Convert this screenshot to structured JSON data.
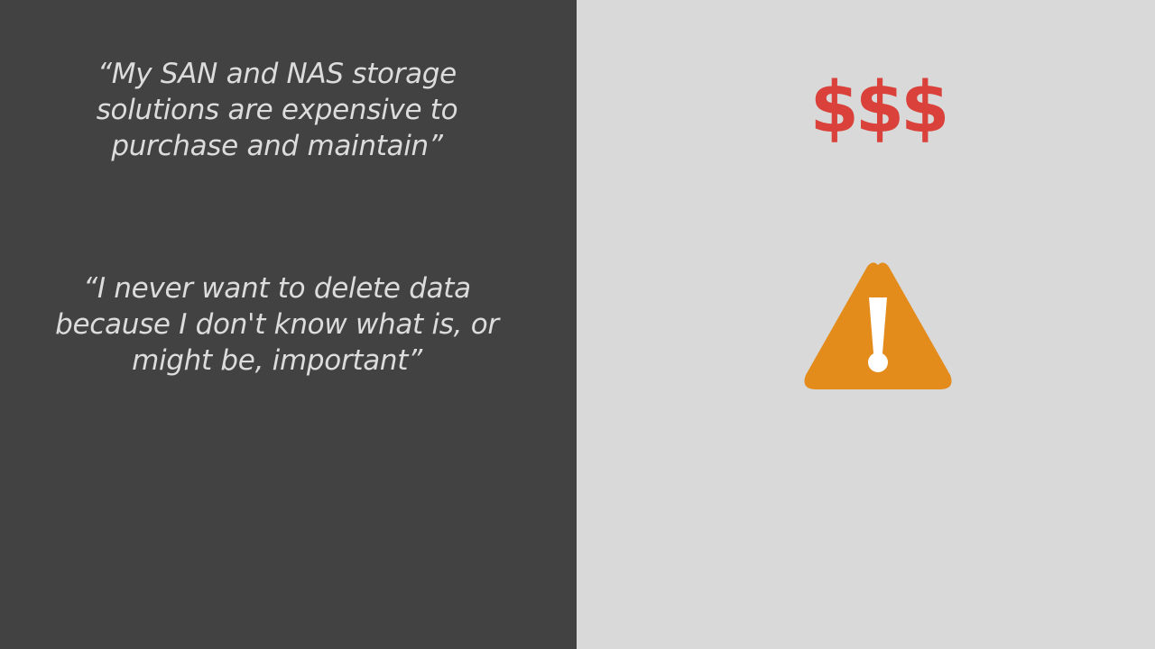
{
  "quotes": [
    {
      "text": "“My SAN and NAS storage\nsolutions are expensive to\npurchase and maintain”"
    },
    {
      "text": "“I never want to delete data\nbecause I don't know what is, or\nmight be, important”"
    }
  ],
  "cost_symbol": {
    "text": "$$$",
    "color": "#d9413a"
  },
  "warning": {
    "icon": "warning-icon",
    "color": "#e38b1b",
    "glyph_color": "#ffffff"
  },
  "colors": {
    "left_background": "#424242",
    "right_background": "#d9d9d9",
    "quote_text": "#dcdcdc"
  }
}
